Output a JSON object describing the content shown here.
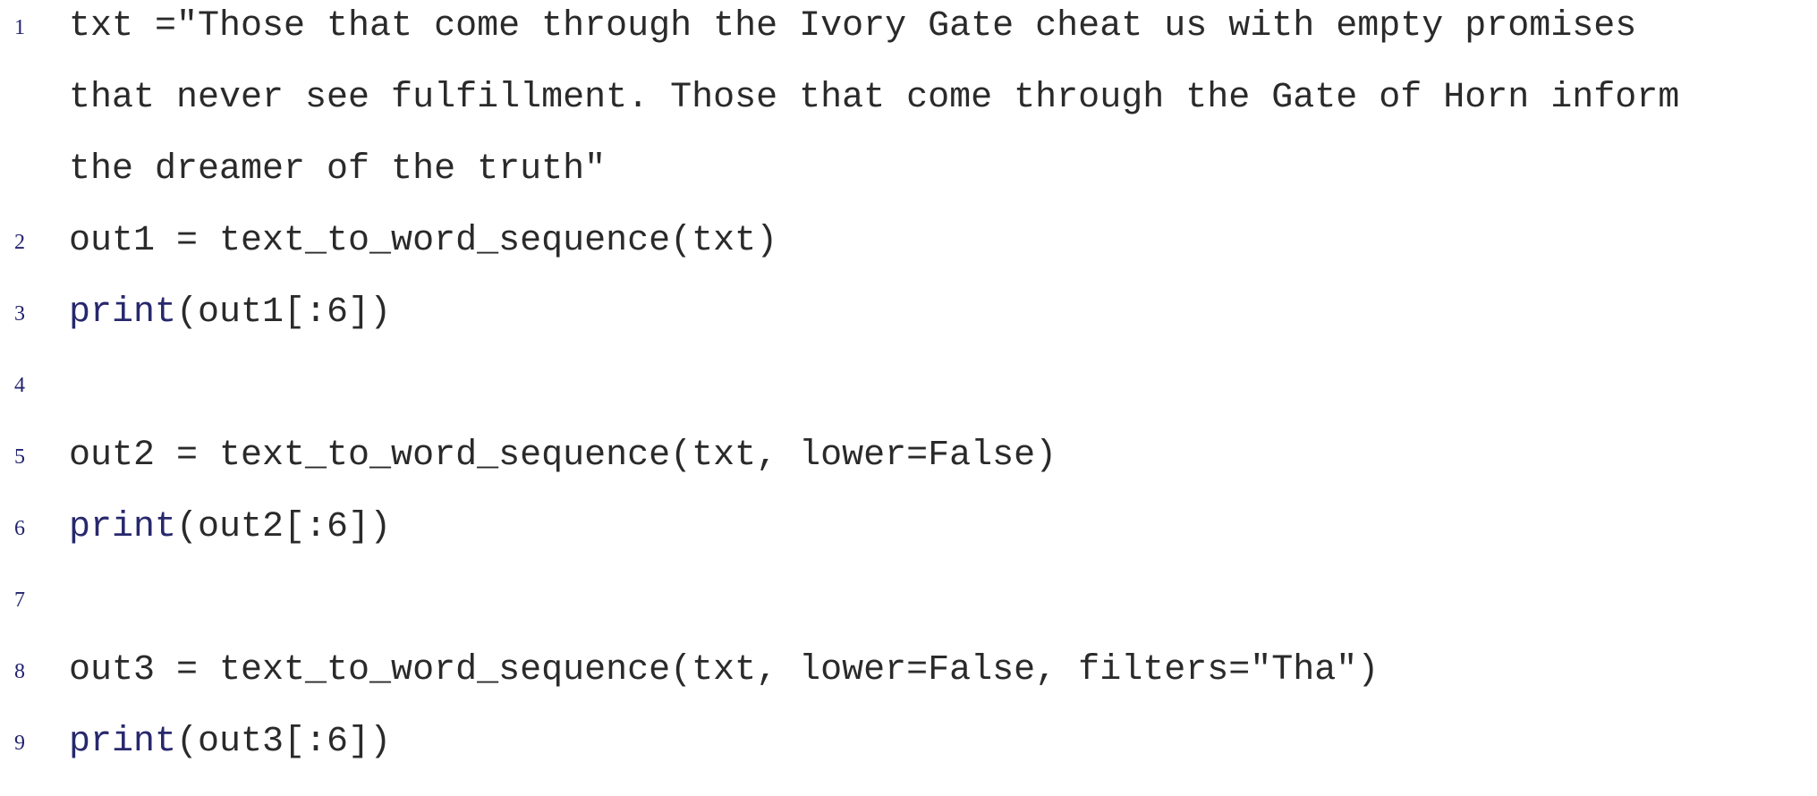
{
  "lines": [
    {
      "number": "1",
      "code": "txt =\"Those that come through the Ivory Gate cheat us with empty promises"
    },
    {
      "number": "",
      "code": "that never see fulfillment. Those that come through the Gate of Horn inform"
    },
    {
      "number": "",
      "code": "the dreamer of the truth\""
    },
    {
      "number": "2",
      "code": "out1 = text_to_word_sequence(txt)"
    },
    {
      "number": "3",
      "keyword": "print",
      "rest": "(out1[:6])"
    },
    {
      "number": "4",
      "code": ""
    },
    {
      "number": "5",
      "code": "out2 = text_to_word_sequence(txt, lower=False)"
    },
    {
      "number": "6",
      "keyword": "print",
      "rest": "(out2[:6])"
    },
    {
      "number": "7",
      "code": ""
    },
    {
      "number": "8",
      "code": "out3 = text_to_word_sequence(txt, lower=False, filters=\"Tha\")"
    },
    {
      "number": "9",
      "keyword": "print",
      "rest": "(out3[:6])"
    }
  ],
  "colors": {
    "text": "#2a2a2a",
    "keyword": "#28286e",
    "line_number": "#23236e",
    "background": "#ffffff"
  }
}
